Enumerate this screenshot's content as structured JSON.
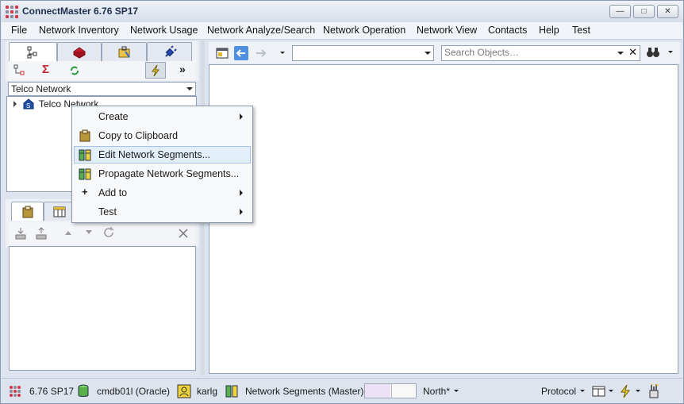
{
  "window": {
    "title": "ConnectMaster 6.76 SP17",
    "minimize": "—",
    "maximize": "□",
    "close": "✕"
  },
  "menu": [
    "File",
    "Network Inventory",
    "Network Usage",
    "Network Analyze/Search",
    "Network Operation",
    "Network View",
    "Contacts",
    "Help",
    "Test"
  ],
  "left_panel": {
    "network_combo": "Telco Network",
    "more_label": "»",
    "tree": {
      "root_label": "Telco Network"
    }
  },
  "right_panel": {
    "search_placeholder": "Search Objects…"
  },
  "context_menu": {
    "items": [
      {
        "label": "Create",
        "submenu": true
      },
      {
        "label": "Copy to Clipboard",
        "submenu": false
      },
      {
        "label": "Edit Network Segments...",
        "submenu": false,
        "highlighted": true
      },
      {
        "label": "Propagate Network Segments...",
        "submenu": false
      },
      {
        "label": "Add to",
        "submenu": true
      },
      {
        "label": "Test",
        "submenu": true
      }
    ]
  },
  "statusbar": {
    "version": "6.76 SP17",
    "database": "cmdb01l (Oracle)",
    "user": "karlg",
    "segments": "Network Segments (Master)",
    "region": "North*",
    "protocol": "Protocol"
  },
  "colors": {
    "accent": "#3a6fc4",
    "highlight": "#e3eefb",
    "segment_fill": "#ede1f7"
  }
}
